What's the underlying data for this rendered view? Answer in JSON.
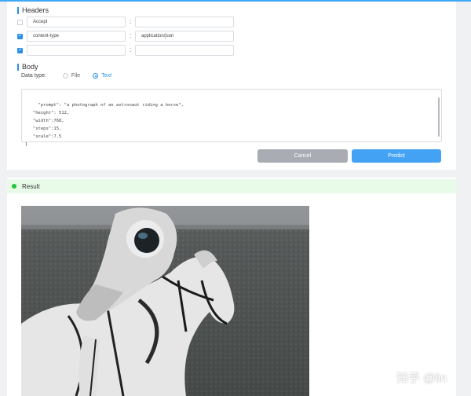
{
  "headers": {
    "title": "Headers",
    "rows": [
      {
        "checked": false,
        "key": "Accept",
        "value": ""
      },
      {
        "checked": true,
        "key": "content-type",
        "value": "application/json"
      },
      {
        "checked": true,
        "key": "",
        "value": ""
      }
    ],
    "separator": ":"
  },
  "body": {
    "title": "Body",
    "data_type_label": "Data type:",
    "options": [
      "File",
      "Text"
    ],
    "selected": "Text",
    "code": "   \"prompt\": \"a photograph of an astronaut riding a horse\",\n   \"height\": 512,\n   \"width\":768,\n   \"steps\":15,\n   \"scale\":7.5\n}"
  },
  "actions": {
    "cancel": "Cancel",
    "predict": "Predict"
  },
  "result": {
    "title": "Result",
    "status_color": "#21c33a"
  },
  "image": {
    "description_icon": "astronaut-riding-horse-image"
  },
  "watermark": {
    "text": "知乎 @lin"
  },
  "colors": {
    "accent": "#2b8ee6",
    "predict_button": "#44a2f5",
    "cancel_button": "#a9adb3",
    "result_background": "#e8fbe9"
  }
}
